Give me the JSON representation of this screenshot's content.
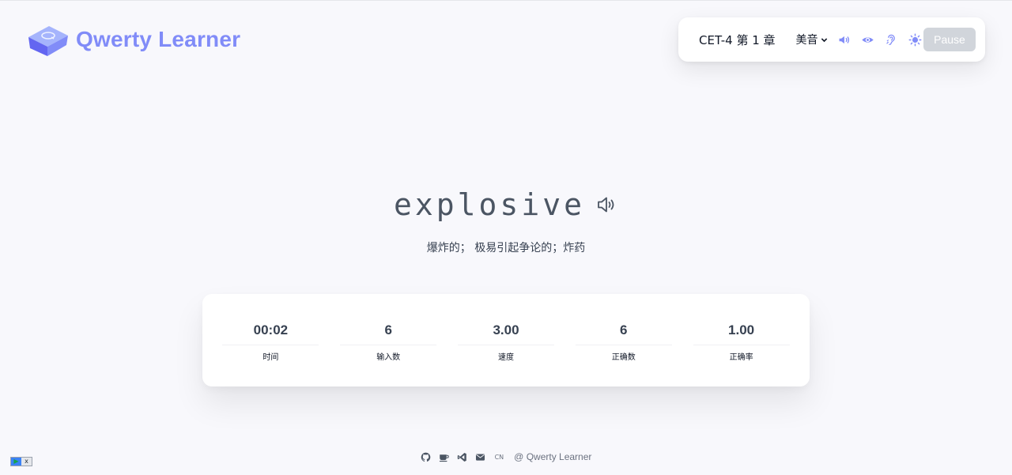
{
  "app": {
    "title": "Qwerty Learner",
    "brand_color": "#818cf8"
  },
  "toolbar": {
    "chapter_label": "CET-4 第 1 章",
    "accent_label": "美音",
    "icons": [
      "volume-icon",
      "eye-icon",
      "ear-icon",
      "sun-icon"
    ],
    "pause_label": "Pause"
  },
  "word": {
    "text": "explosive",
    "translation": "爆炸的； 极易引起争论的；炸药"
  },
  "stats": [
    {
      "value": "00:02",
      "label": "时间"
    },
    {
      "value": "6",
      "label": "输入数"
    },
    {
      "value": "3.00",
      "label": "速度"
    },
    {
      "value": "6",
      "label": "正确数"
    },
    {
      "value": "1.00",
      "label": "正确率"
    }
  ],
  "footer": {
    "icons": [
      "github-icon",
      "coffee-icon",
      "vscode-icon",
      "mail-icon"
    ],
    "lang_label": "CN",
    "copyright": "@ Qwerty Learner"
  }
}
